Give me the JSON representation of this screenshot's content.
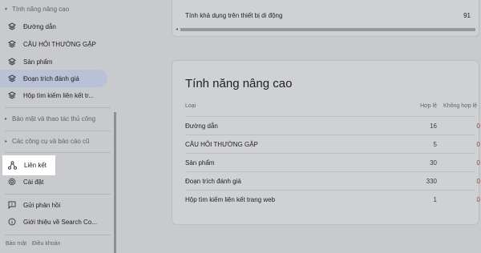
{
  "sidebar": {
    "section_advanced": "Tính năng nâng cao",
    "items": [
      {
        "label": "Đường dẫn",
        "icon": "layers-icon"
      },
      {
        "label": "CÂU HỎI THƯỜNG GẶP",
        "icon": "layers-icon"
      },
      {
        "label": "Sản phẩm",
        "icon": "layers-icon"
      },
      {
        "label": "Đoạn trích đánh giá",
        "icon": "layers-icon"
      },
      {
        "label": "Hộp tìm kiếm liên kết tr...",
        "icon": "layers-icon"
      }
    ],
    "section_security": "Bảo mật và thao tác thủ công",
    "section_legacy": "Các công cụ và báo cáo cũ",
    "links": "Liên kết",
    "settings": "Cài đặt",
    "feedback": "Gửi phản hồi",
    "about": "Giới thiệu về Search Co...",
    "footer_privacy": "Bảo mật",
    "footer_terms": "Điều khoản"
  },
  "mobile_row": {
    "label": "Tính khả dụng trên thiết bị di động",
    "value": "91"
  },
  "advanced": {
    "title": "Tính năng nâng cao",
    "columns": {
      "type": "Loại",
      "valid": "Hợp lệ",
      "invalid": "Không hợp lệ"
    },
    "rows": [
      {
        "label": "Đường dẫn",
        "valid": "16",
        "invalid": "0"
      },
      {
        "label": "CÂU HỎI THƯỜNG GẶP",
        "valid": "5",
        "invalid": "0"
      },
      {
        "label": "Sản phẩm",
        "valid": "30",
        "invalid": "0"
      },
      {
        "label": "Đoạn trích đánh giá",
        "valid": "330",
        "invalid": "0"
      },
      {
        "label": "Hộp tìm kiếm liên kết trang web",
        "valid": "1",
        "invalid": "0"
      }
    ]
  },
  "colors": {
    "invalid_count": "#b33a2e",
    "selected_item": "#b9c1d6",
    "overlay_bg": "#c9cacd"
  }
}
